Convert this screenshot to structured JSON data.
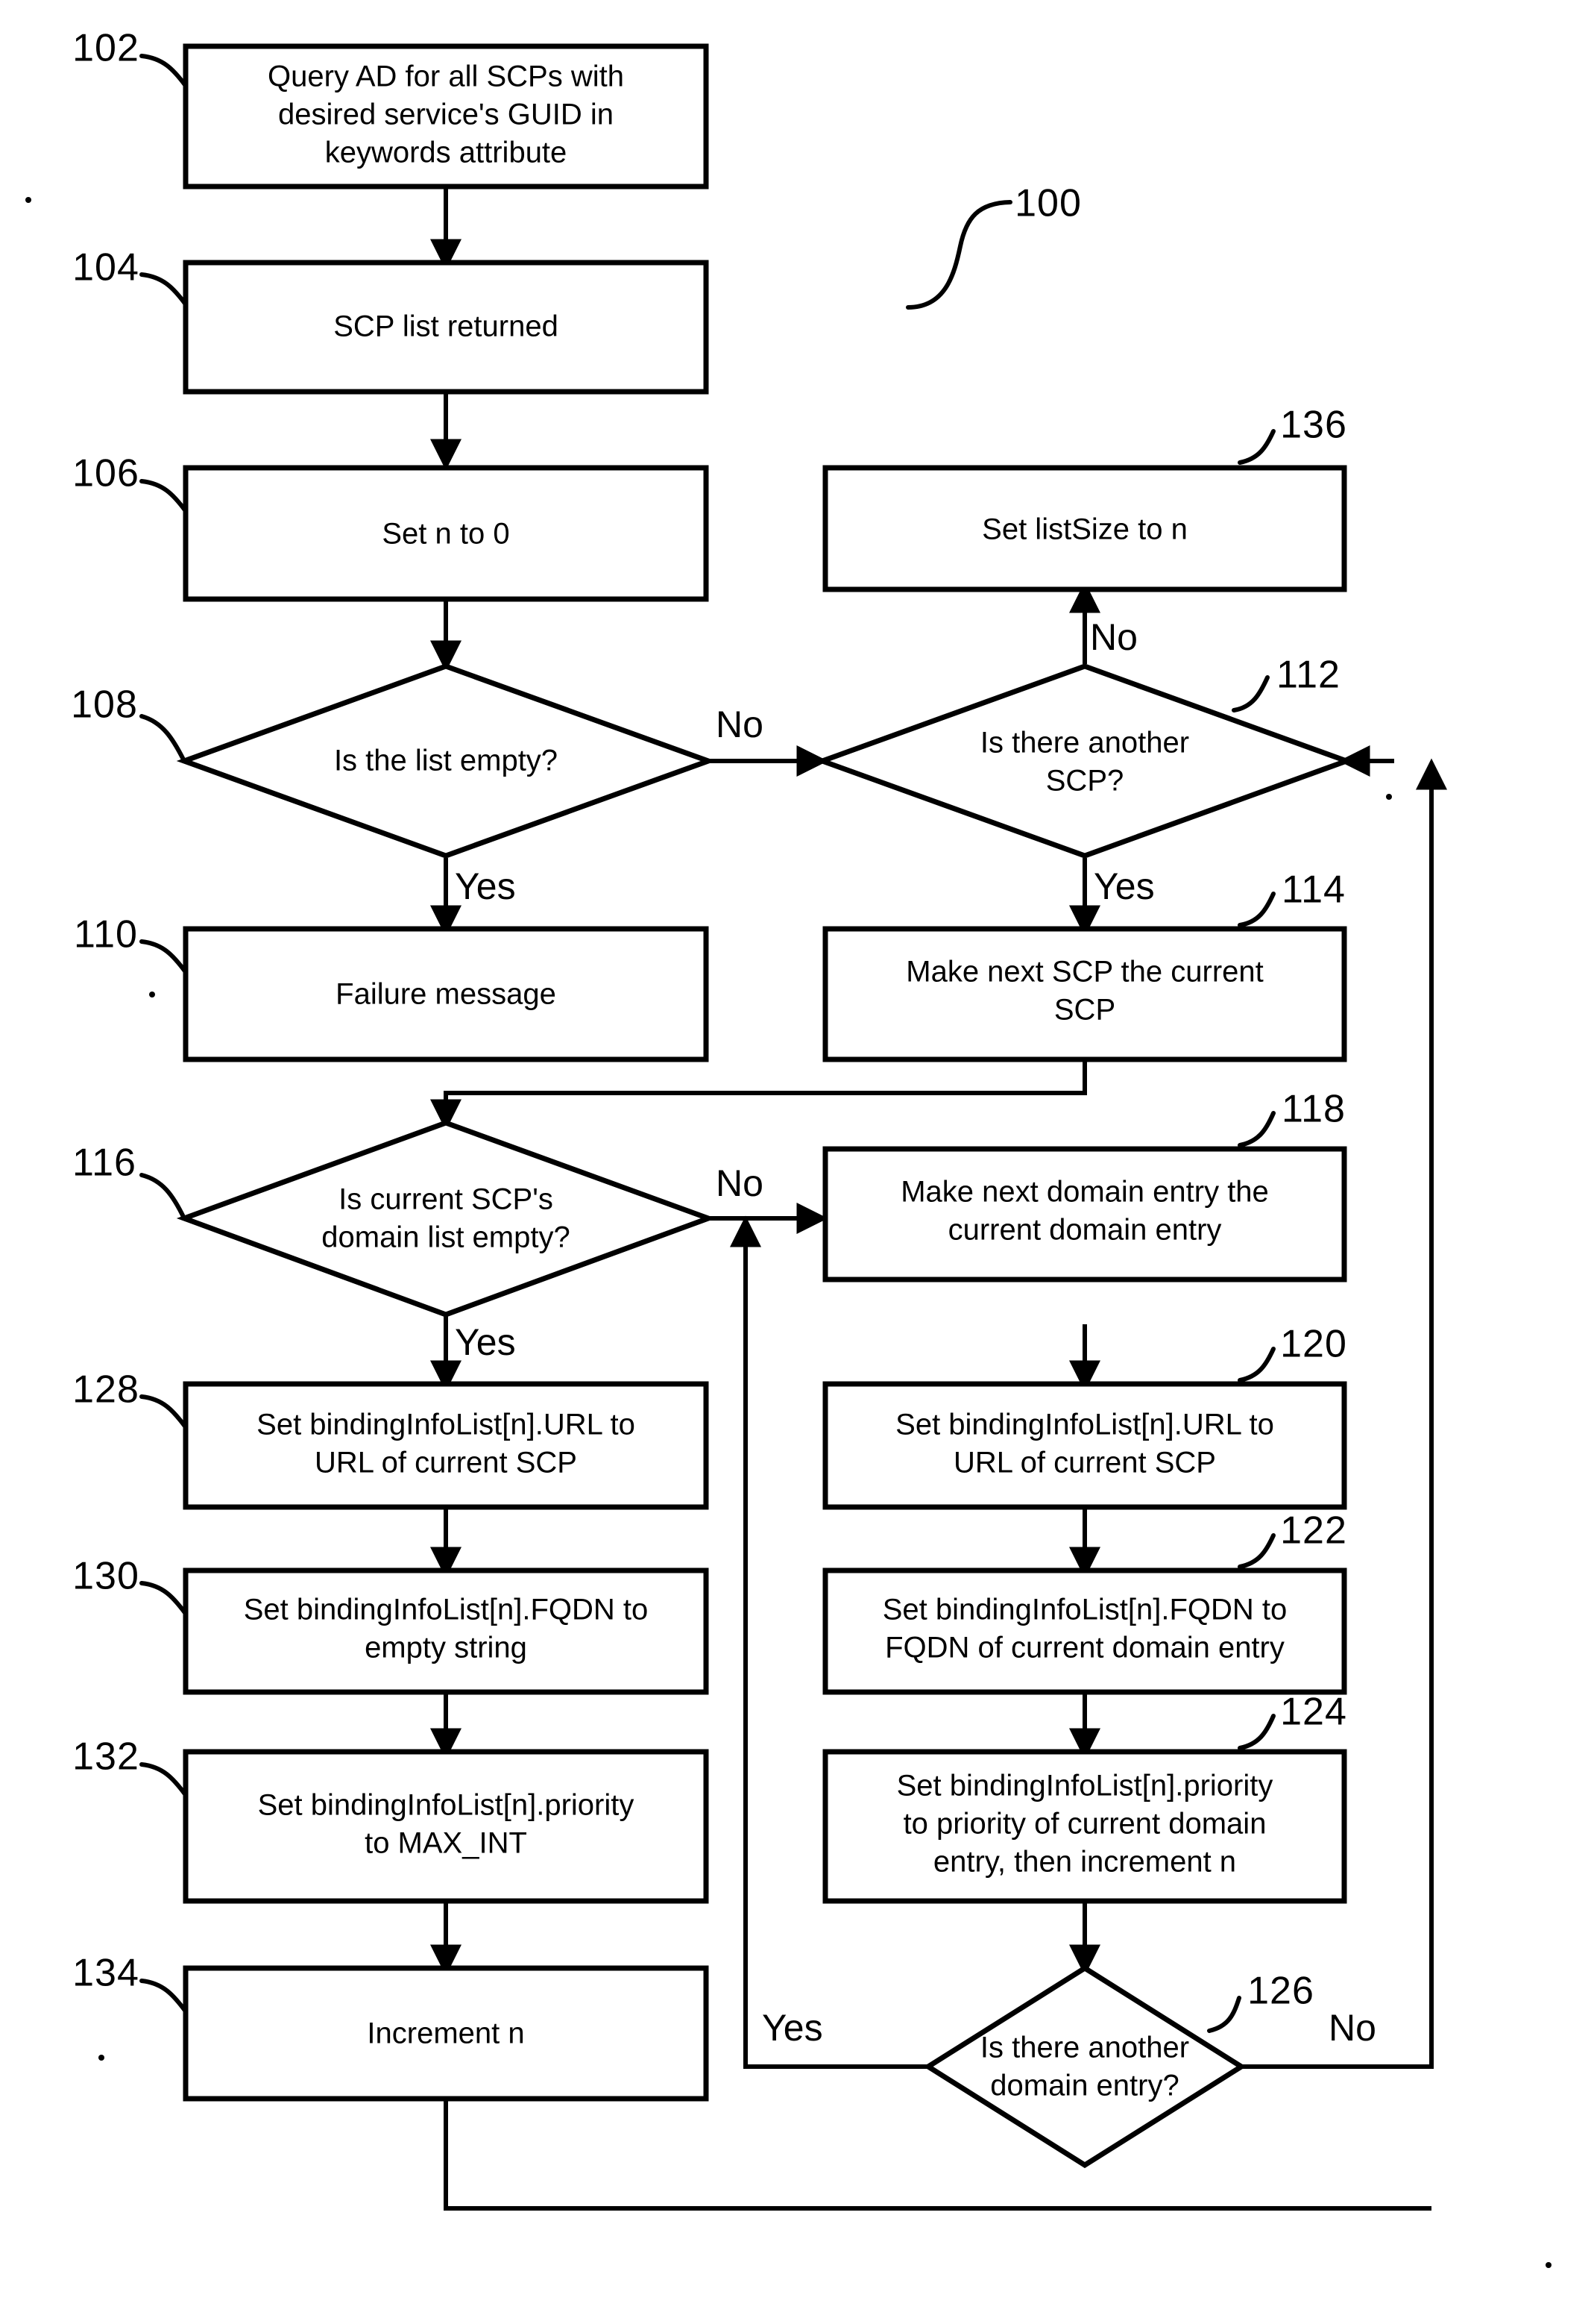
{
  "figure": {
    "label": "100",
    "type": "flowchart"
  },
  "nodes": {
    "n102": {
      "ref": "102",
      "shape": "process",
      "lines": [
        "Query AD for all SCPs with",
        "desired service's GUID in",
        "keywords attribute"
      ]
    },
    "n104": {
      "ref": "104",
      "shape": "process",
      "lines": [
        "SCP list returned"
      ]
    },
    "n106": {
      "ref": "106",
      "shape": "process",
      "lines": [
        "Set n to 0"
      ]
    },
    "n108": {
      "ref": "108",
      "shape": "decision",
      "lines": [
        "Is the list empty?"
      ]
    },
    "n110": {
      "ref": "110",
      "shape": "process",
      "lines": [
        "Failure message"
      ]
    },
    "n112": {
      "ref": "112",
      "shape": "decision",
      "lines": [
        "Is there another",
        "SCP?"
      ]
    },
    "n114": {
      "ref": "114",
      "shape": "process",
      "lines": [
        "Make next SCP the current",
        "SCP"
      ]
    },
    "n116": {
      "ref": "116",
      "shape": "decision",
      "lines": [
        "Is current SCP's",
        "domain list empty?"
      ]
    },
    "n118": {
      "ref": "118",
      "shape": "process",
      "lines": [
        "Make next domain entry the",
        "current domain entry"
      ]
    },
    "n120": {
      "ref": "120",
      "shape": "process",
      "lines": [
        "Set bindingInfoList[n].URL to",
        "URL of current SCP"
      ]
    },
    "n122": {
      "ref": "122",
      "shape": "process",
      "lines": [
        "Set bindingInfoList[n].FQDN to",
        "FQDN of current domain entry"
      ]
    },
    "n124": {
      "ref": "124",
      "shape": "process",
      "lines": [
        "Set bindingInfoList[n].priority",
        "to priority of current domain",
        "entry, then increment n"
      ]
    },
    "n126": {
      "ref": "126",
      "shape": "decision",
      "lines": [
        "Is there another",
        "domain entry?"
      ]
    },
    "n128": {
      "ref": "128",
      "shape": "process",
      "lines": [
        "Set bindingInfoList[n].URL to",
        "URL of current SCP"
      ]
    },
    "n130": {
      "ref": "130",
      "shape": "process",
      "lines": [
        "Set bindingInfoList[n].FQDN to",
        "empty string"
      ]
    },
    "n132": {
      "ref": "132",
      "shape": "process",
      "lines": [
        "Set bindingInfoList[n].priority",
        "to MAX_INT"
      ]
    },
    "n134": {
      "ref": "134",
      "shape": "process",
      "lines": [
        "Increment n"
      ]
    },
    "n136": {
      "ref": "136",
      "shape": "process",
      "lines": [
        "Set listSize to n"
      ]
    }
  },
  "edge_labels": {
    "e108_no": "No",
    "e108_yes": "Yes",
    "e112_no": "No",
    "e112_yes": "Yes",
    "e116_no": "No",
    "e116_yes": "Yes",
    "e126_yes": "Yes",
    "e126_no": "No"
  },
  "colors": {
    "ink": "#000000",
    "paper": "#ffffff"
  }
}
